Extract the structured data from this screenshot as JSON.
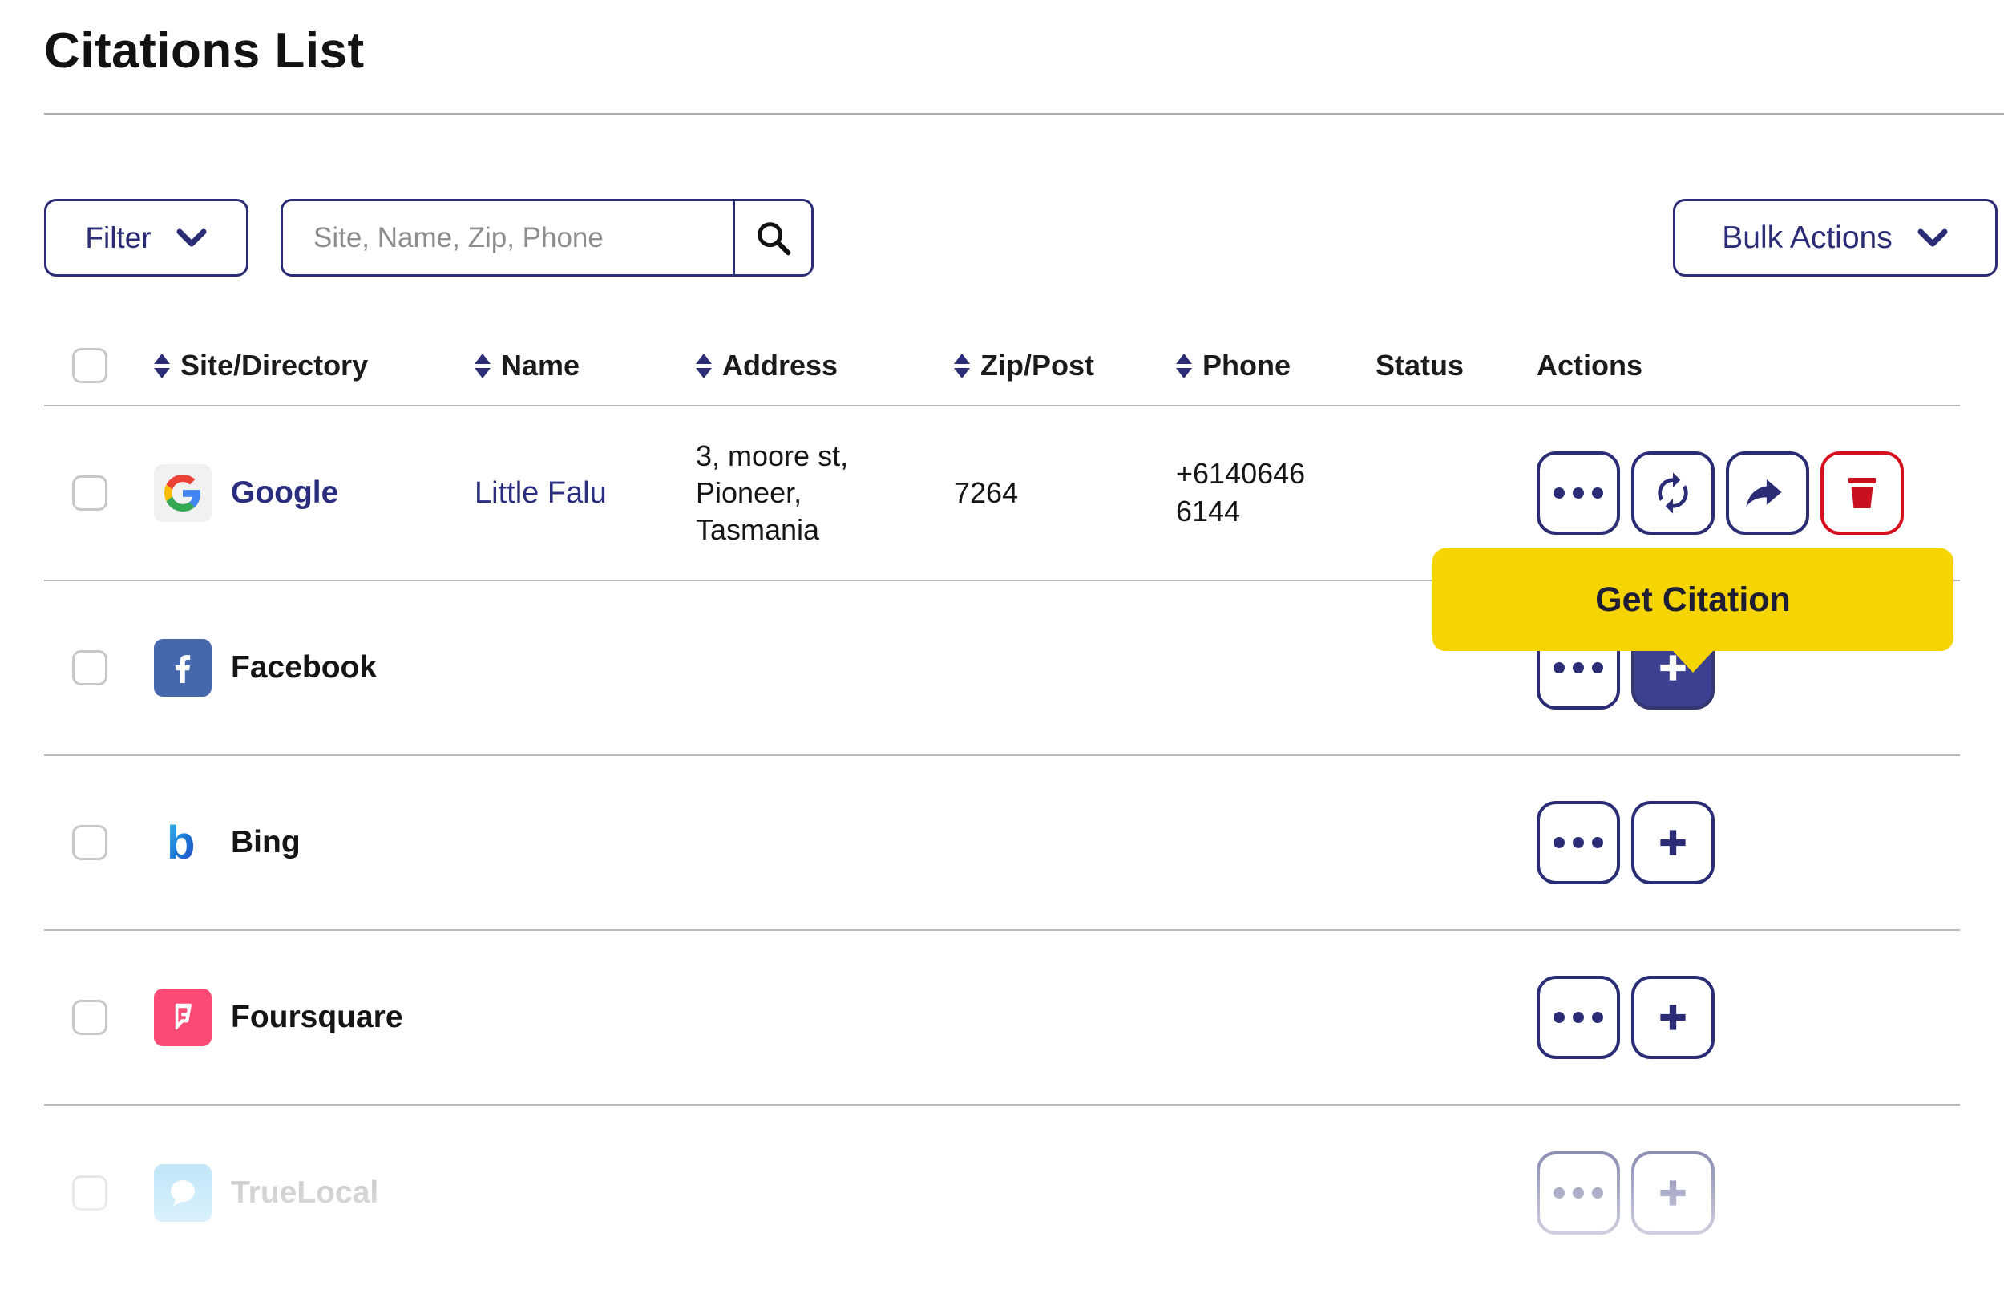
{
  "page": {
    "title": "Citations List"
  },
  "toolbar": {
    "filter_label": "Filter",
    "search_placeholder": "Site, Name, Zip, Phone",
    "search_value": "",
    "bulk_actions_label": "Bulk Actions"
  },
  "table": {
    "columns": [
      {
        "label": "Site/Directory",
        "sortable": true
      },
      {
        "label": "Name",
        "sortable": true
      },
      {
        "label": "Address",
        "sortable": true
      },
      {
        "label": "Zip/Post",
        "sortable": true
      },
      {
        "label": "Phone",
        "sortable": true
      },
      {
        "label": "Status",
        "sortable": false
      },
      {
        "label": "Actions",
        "sortable": false
      }
    ],
    "rows": [
      {
        "site": "Google",
        "name": "Little Falu",
        "address": "3, moore st, Pioneer, Tasmania",
        "zip": "7264",
        "phone": "+6140646 6144",
        "status": "",
        "actions": [
          "more",
          "sync",
          "share",
          "delete"
        ],
        "selected": false,
        "disabled": false
      },
      {
        "site": "Facebook",
        "name": "",
        "address": "",
        "zip": "",
        "phone": "",
        "status": "",
        "actions": [
          "more",
          "add-filled"
        ],
        "selected": false,
        "disabled": false
      },
      {
        "site": "Bing",
        "name": "",
        "address": "",
        "zip": "",
        "phone": "",
        "status": "",
        "actions": [
          "more",
          "add"
        ],
        "selected": false,
        "disabled": false
      },
      {
        "site": "Foursquare",
        "name": "",
        "address": "",
        "zip": "",
        "phone": "",
        "status": "",
        "actions": [
          "more",
          "add"
        ],
        "selected": false,
        "disabled": false
      },
      {
        "site": "TrueLocal",
        "name": "",
        "address": "",
        "zip": "",
        "phone": "",
        "status": "",
        "actions": [
          "more",
          "add"
        ],
        "selected": false,
        "disabled": true
      }
    ]
  },
  "tooltip": {
    "label": "Get Citation"
  },
  "icons": {
    "filter_button": "chevron-down-icon",
    "bulk_actions_button": "chevron-down-icon",
    "search_button": "magnifier-icon",
    "sortable_column": "sort-arrows-icon",
    "more": "ellipsis-icon",
    "sync": "sync-arrows-icon",
    "share": "share-arrow-icon",
    "delete": "trash-icon",
    "add": "plus-icon"
  },
  "colors": {
    "accent_navy": "#2a2d75",
    "link_navy": "#2b2e7e",
    "filled_plus_bg": "#3c4090",
    "delete_red": "#d60f1f",
    "tooltip_yellow": "#f6d402",
    "divider_gray": "#b9b9b9",
    "google_brand": [
      "#4285F4",
      "#EA4335",
      "#FBBC05",
      "#34A853"
    ],
    "facebook_brand": "#4568ad",
    "foursquare_brand": "#fb4a73",
    "truelocal_brand": "#7ecdf3"
  }
}
